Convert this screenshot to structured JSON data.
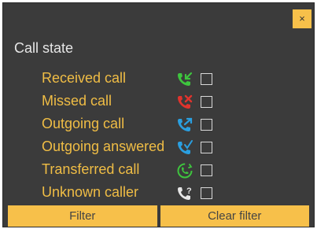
{
  "dialog": {
    "close_label": "×",
    "section_title": "Call state"
  },
  "call_states": [
    {
      "label": "Received call",
      "icon": "received-call-icon",
      "checked": false
    },
    {
      "label": "Missed call",
      "icon": "missed-call-icon",
      "checked": false
    },
    {
      "label": "Outgoing call",
      "icon": "outgoing-call-icon",
      "checked": false
    },
    {
      "label": "Outgoing answered",
      "icon": "outgoing-answered-icon",
      "checked": false
    },
    {
      "label": "Transferred call",
      "icon": "transferred-call-icon",
      "checked": false
    },
    {
      "label": "Unknown caller",
      "icon": "unknown-caller-icon",
      "checked": false
    }
  ],
  "footer": {
    "filter_label": "Filter",
    "clear_label": "Clear filter"
  },
  "colors": {
    "panel_bg": "#3b3b3b",
    "accent": "#f7c04a",
    "label": "#f0bd45",
    "received": "#3ec43e",
    "missed": "#e0332d",
    "outgoing": "#2a9fe0",
    "transferred": "#3ec43e",
    "unknown": "#e6e6e6"
  }
}
